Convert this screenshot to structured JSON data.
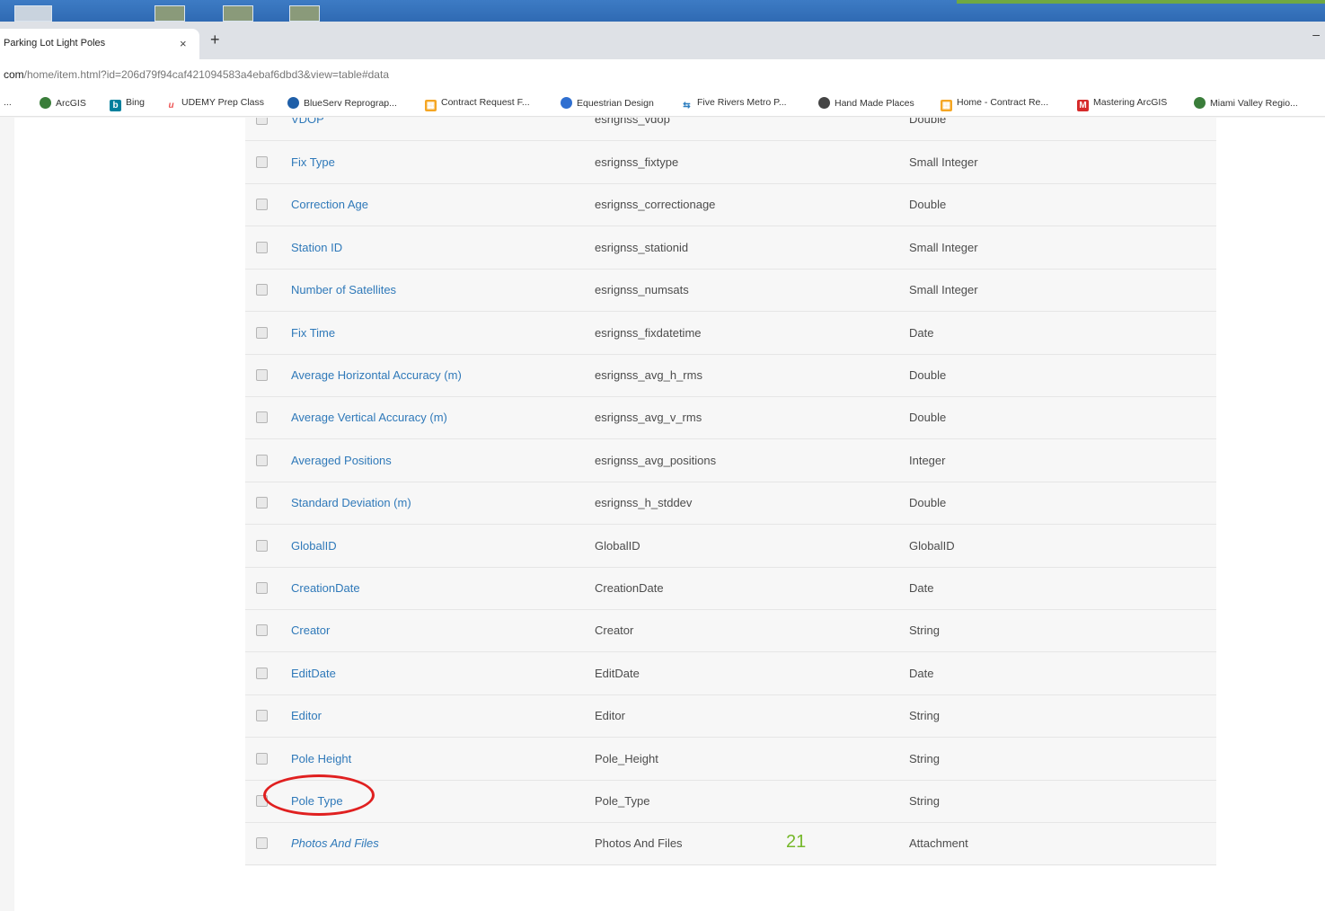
{
  "browser": {
    "tab_title": "Parking Lot Light Poles",
    "tab_close": "×",
    "new_tab": "+",
    "minimize": "–",
    "url_host": "com",
    "url_path": "/home/item.html?id=206d79f94caf421094583a4ebaf6dbd3&view=table#data"
  },
  "bookmarks": {
    "overflow": "...",
    "items": [
      {
        "label": "ArcGIS",
        "icon": "globe-icon",
        "color": "#3a7d3a"
      },
      {
        "label": "Bing",
        "icon": "bing-icon",
        "color": "#00809d"
      },
      {
        "label": "UDEMY Prep Class",
        "icon": "udemy-icon",
        "color": "#ec5252"
      },
      {
        "label": "BlueServ Reprograp...",
        "icon": "globe-icon",
        "color": "#1f5fa8"
      },
      {
        "label": "Contract Request F...",
        "icon": "office-icon",
        "color": "#f5a623"
      },
      {
        "label": "Equestrian Design",
        "icon": "site-icon",
        "color": "#2f6fd0"
      },
      {
        "label": "Five Rivers Metro P...",
        "icon": "arrows-icon",
        "color": "#2f7fc0"
      },
      {
        "label": "Hand Made Places",
        "icon": "globe-icon",
        "color": "#444444"
      },
      {
        "label": "Home - Contract Re...",
        "icon": "office-icon",
        "color": "#f5a623"
      },
      {
        "label": "Mastering ArcGIS",
        "icon": "m-icon",
        "color": "#d62b2b"
      },
      {
        "label": "Miami Valley Regio...",
        "icon": "globe-icon",
        "color": "#3a7d3a"
      }
    ]
  },
  "fields": {
    "partial_row": {
      "alias": "VDOP",
      "name": "esrignss_vdop",
      "type": "Double"
    },
    "rows": [
      {
        "alias": "Fix Type",
        "name": "esrignss_fixtype",
        "type": "Small Integer"
      },
      {
        "alias": "Correction Age",
        "name": "esrignss_correctionage",
        "type": "Double"
      },
      {
        "alias": "Station ID",
        "name": "esrignss_stationid",
        "type": "Small Integer"
      },
      {
        "alias": "Number of Satellites",
        "name": "esrignss_numsats",
        "type": "Small Integer"
      },
      {
        "alias": "Fix Time",
        "name": "esrignss_fixdatetime",
        "type": "Date"
      },
      {
        "alias": "Average Horizontal Accuracy (m)",
        "name": "esrignss_avg_h_rms",
        "type": "Double"
      },
      {
        "alias": "Average Vertical Accuracy (m)",
        "name": "esrignss_avg_v_rms",
        "type": "Double"
      },
      {
        "alias": "Averaged Positions",
        "name": "esrignss_avg_positions",
        "type": "Integer"
      },
      {
        "alias": "Standard Deviation (m)",
        "name": "esrignss_h_stddev",
        "type": "Double"
      },
      {
        "alias": "GlobalID",
        "name": "GlobalID",
        "type": "GlobalID"
      },
      {
        "alias": "CreationDate",
        "name": "CreationDate",
        "type": "Date"
      },
      {
        "alias": "Creator",
        "name": "Creator",
        "type": "String"
      },
      {
        "alias": "EditDate",
        "name": "EditDate",
        "type": "Date"
      },
      {
        "alias": "Editor",
        "name": "Editor",
        "type": "String"
      },
      {
        "alias": "Pole Height",
        "name": "Pole_Height",
        "type": "String"
      },
      {
        "alias": "Pole Type",
        "name": "Pole_Type",
        "type": "String"
      },
      {
        "alias": "Photos And Files",
        "name": "Photos And Files",
        "type": "Attachment",
        "italic": true
      }
    ]
  },
  "annotation": {
    "number": "21",
    "circle_color": "#e02020",
    "number_color": "#76b82a"
  }
}
